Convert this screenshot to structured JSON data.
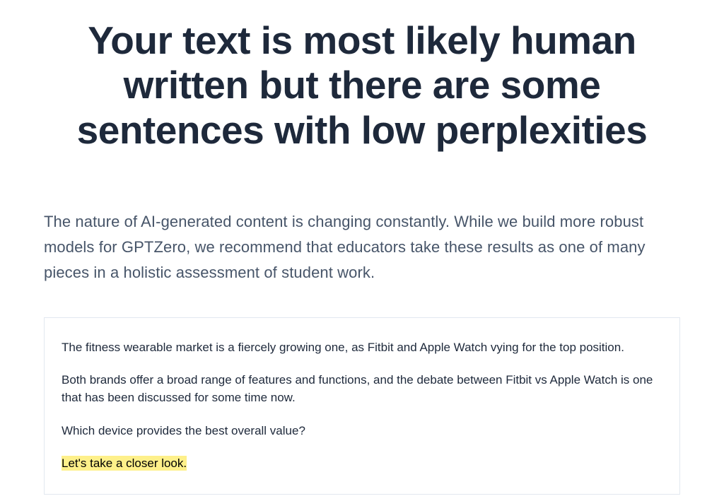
{
  "headline": "Your text is most likely human written but there are some sentences with low perplexities",
  "description": "The nature of AI-generated content is changing constantly. While we build more robust models for GPTZero, we recommend that educators take these results as one of many pieces in a holistic assessment of student work.",
  "analysis": {
    "paragraphs": [
      "The fitness wearable market is a fiercely growing one, as Fitbit and Apple Watch vying for the top position.",
      "Both brands offer a broad range of features and functions, and the debate between Fitbit vs Apple Watch is one that has been discussed for some time now.",
      "Which device provides the best overall value?"
    ],
    "highlighted": "Let's take a closer look."
  },
  "colors": {
    "headline": "#1e293b",
    "body": "#475569",
    "highlight_bg": "#fef08a",
    "border": "#e2e8f0"
  }
}
